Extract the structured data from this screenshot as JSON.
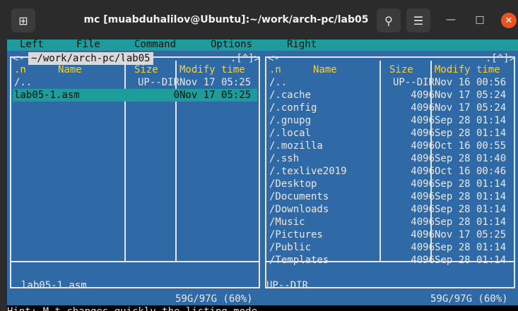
{
  "window": {
    "title": "mc [muabduhalilov@Ubuntu]:~/work/arch-pc/lab05"
  },
  "menu": [
    "Left",
    "File",
    "Command",
    "Options",
    "Right"
  ],
  "left_panel": {
    "path": " ~/work/arch-pc/lab05 ",
    "top_left": "<-",
    "top_right": ".[^]>",
    "headers": {
      "n": ".n",
      "name": "Name",
      "size": "Size",
      "modify": "Modify time"
    },
    "rows": [
      {
        "name": "/..",
        "size": "UP--DIR",
        "date": "Nov 17 05:25"
      },
      {
        "name": "lab05-1.asm",
        "size": "0",
        "date": "Nov 17 05:25",
        "selected": true
      }
    ],
    "mini_status": "lab05-1.asm",
    "disk": " 59G/97G (60%) "
  },
  "right_panel": {
    "path": "",
    "top_left": "<-",
    "top_right": ".[^]>",
    "headers": {
      "n": ".n",
      "name": "Name",
      "size": "Size",
      "modify": "Modify time"
    },
    "rows": [
      {
        "name": "/..",
        "size": "UP--DIR",
        "date": "Nov 16 00:56"
      },
      {
        "name": "/.cache",
        "size": "4096",
        "date": "Nov 17 05:24"
      },
      {
        "name": "/.config",
        "size": "4096",
        "date": "Nov 17 05:24"
      },
      {
        "name": "/.gnupg",
        "size": "4096",
        "date": "Sep 28 01:14"
      },
      {
        "name": "/.local",
        "size": "4096",
        "date": "Sep 28 01:14"
      },
      {
        "name": "/.mozilla",
        "size": "4096",
        "date": "Oct 16 00:55"
      },
      {
        "name": "/.ssh",
        "size": "4096",
        "date": "Sep 28 01:40"
      },
      {
        "name": "/.texlive2019",
        "size": "4096",
        "date": "Oct 16 00:46"
      },
      {
        "name": "/Desktop",
        "size": "4096",
        "date": "Sep 28 01:14"
      },
      {
        "name": "/Documents",
        "size": "4096",
        "date": "Sep 28 01:14"
      },
      {
        "name": "/Downloads",
        "size": "4096",
        "date": "Sep 28 01:14"
      },
      {
        "name": "/Music",
        "size": "4096",
        "date": "Sep 28 01:14"
      },
      {
        "name": "/Pictures",
        "size": "4096",
        "date": "Nov 17 05:25"
      },
      {
        "name": "/Public",
        "size": "4096",
        "date": "Sep 28 01:14"
      },
      {
        "name": "/Templates",
        "size": "4096",
        "date": "Sep 28 01:14"
      }
    ],
    "mini_status": "UP--DIR",
    "disk": " 59G/97G (60%) "
  },
  "hint": "Hint: M-t changes quickly the listing mode."
}
